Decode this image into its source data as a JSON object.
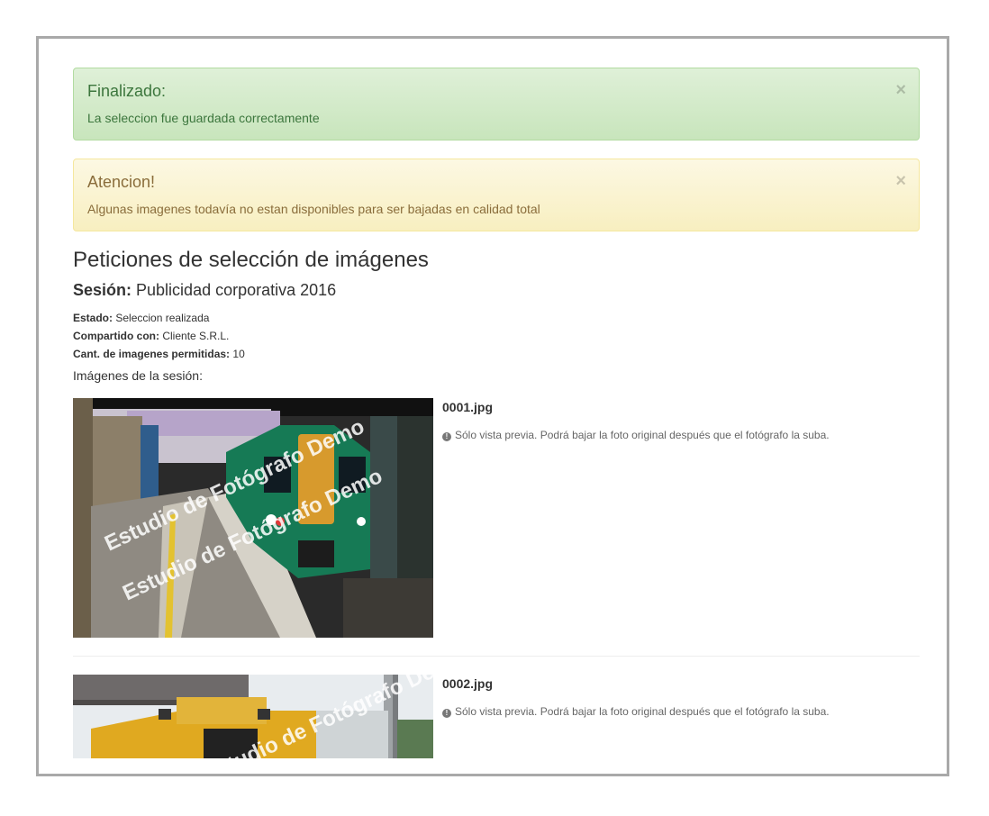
{
  "alerts": {
    "success": {
      "title": "Finalizado:",
      "message": "La seleccion fue guardada correctamente",
      "close": "×"
    },
    "warning": {
      "title": "Atencion!",
      "message": "Algunas imagenes todavía no estan disponibles para ser bajadas en calidad total",
      "close": "×"
    }
  },
  "page": {
    "title": "Peticiones de selección de imágenes",
    "session_label": "Sesión:",
    "session_name": "Publicidad corporativa 2016",
    "status_label": "Estado:",
    "status_value": "Seleccion realizada",
    "shared_label": "Compartido con:",
    "shared_value": "Cliente S.R.L.",
    "count_label": "Cant. de imagenes permitidas:",
    "count_value": "10",
    "images_label": "Imágenes de la sesión:"
  },
  "images": [
    {
      "filename": "0001.jpg",
      "note": "Sólo vista previa. Podrá bajar la foto original después que el fotógrafo la suba.",
      "watermark": "Estudio de Fotógrafo Demo"
    },
    {
      "filename": "0002.jpg",
      "note": "Sólo vista previa. Podrá bajar la foto original después que el fotógrafo la suba.",
      "watermark": "Estudio de Fotógrafo Demo"
    }
  ],
  "colors": {
    "success_text": "#3c763d",
    "warning_text": "#8a6d3b",
    "frame_border": "#a9a9a9"
  },
  "icons": {
    "close": "close-icon",
    "info": "info-circle-icon"
  }
}
